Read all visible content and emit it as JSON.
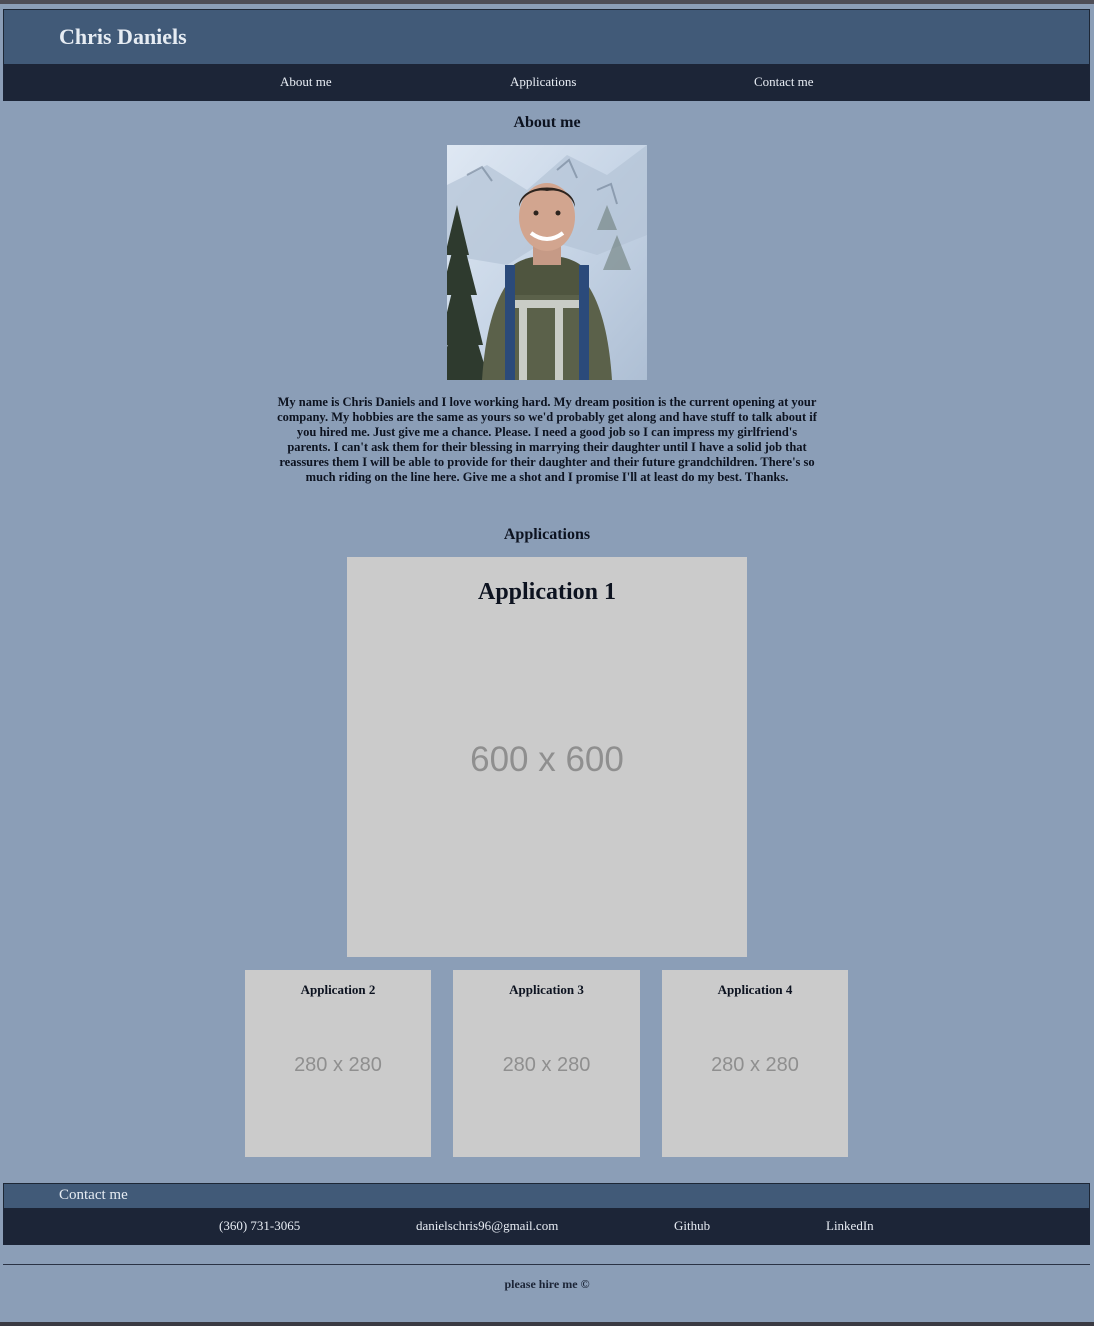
{
  "header": {
    "title": "Chris Daniels"
  },
  "nav": {
    "about": "About me",
    "applications": "Applications",
    "contact": "Contact me"
  },
  "about": {
    "heading": "About me",
    "bio": "My name is Chris Daniels and I love working hard. My dream position is the current opening at your company. My hobbies are the same as yours so we'd probably get along and have stuff to talk about if you hired me. Just give me a chance. Please. I need a good job so I can impress my girlfriend's parents. I can't ask them for their blessing in marrying their daughter until I have a solid job that reassures them I will be able to provide for their daughter and their future grandchildren. There's so much riding on the line here. Give me a shot and I promise I'll at least do my best. Thanks."
  },
  "applications": {
    "heading": "Applications",
    "featured": {
      "title": "Application 1",
      "placeholder": "600 x 600"
    },
    "items": [
      {
        "title": "Application 2",
        "placeholder": "280 x 280"
      },
      {
        "title": "Application 3",
        "placeholder": "280 x 280"
      },
      {
        "title": "Application 4",
        "placeholder": "280 x 280"
      }
    ]
  },
  "contact": {
    "heading": "Contact me",
    "phone": "(360) 731-3065",
    "email": "danielschris96@gmail.com",
    "github": "Github",
    "linkedin": "LinkedIn"
  },
  "footer": {
    "note": "please hire me ©"
  },
  "colors": {
    "page_background": "#8b9eb7",
    "header_background": "#415a78",
    "nav_background": "#1c2537",
    "card_background": "#cbcbcb"
  }
}
